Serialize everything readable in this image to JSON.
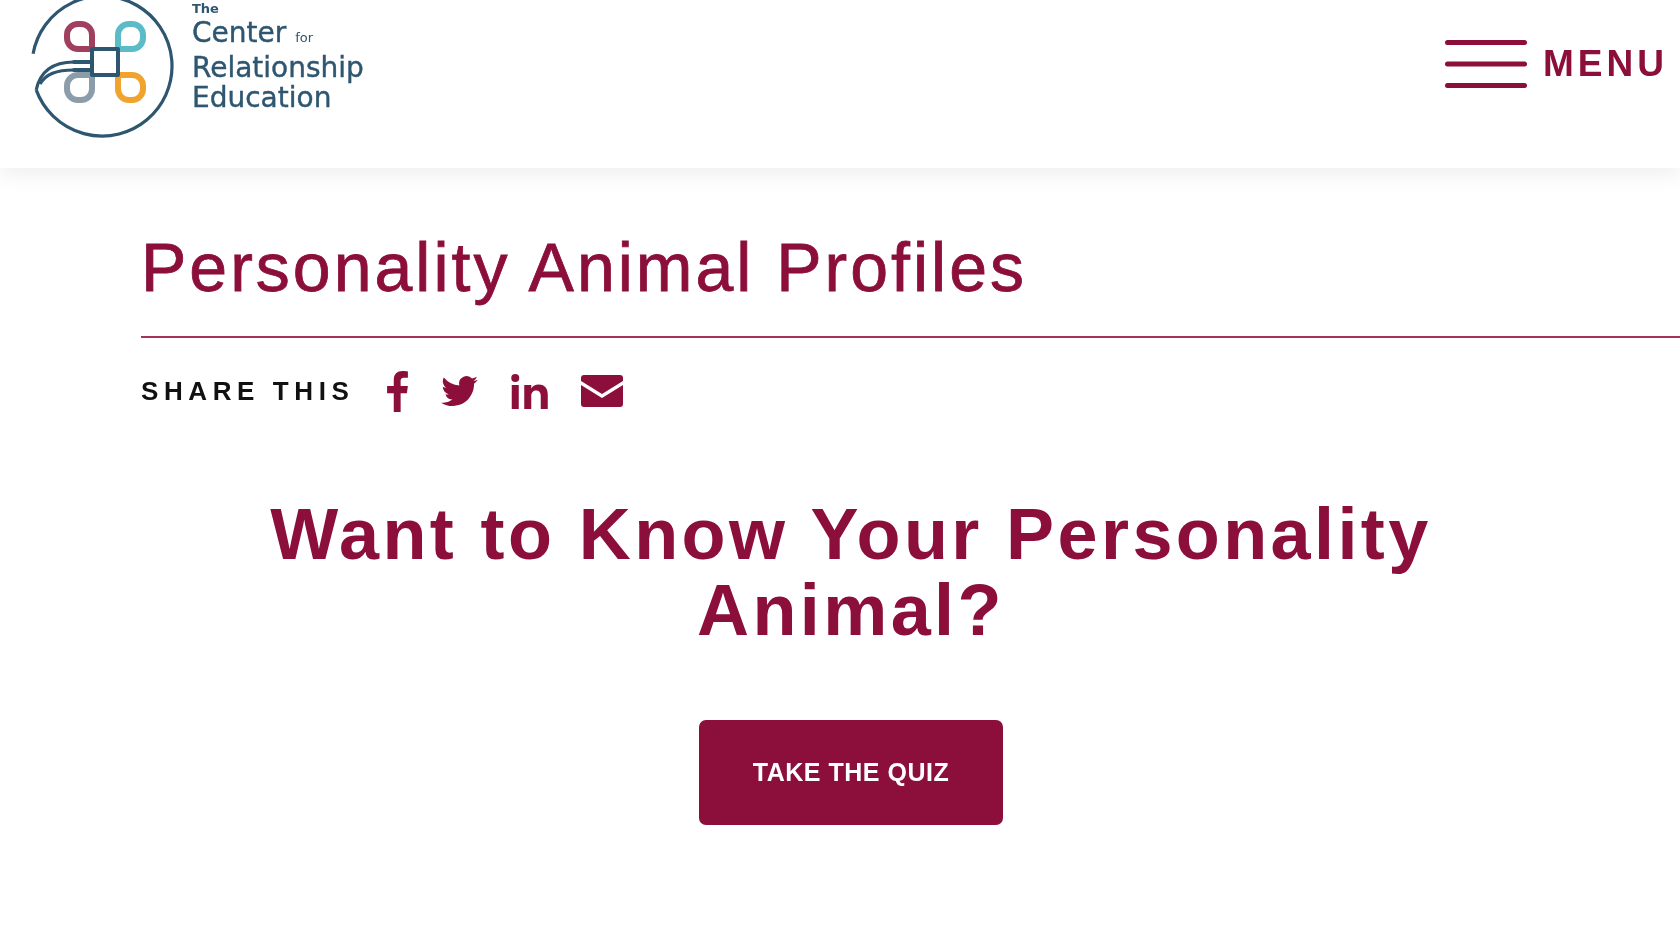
{
  "header": {
    "logo": {
      "top": "The",
      "line_1": "Center",
      "line_1_small": "for",
      "line_2": "Relationship",
      "line_3": "Education"
    },
    "menu": {
      "label": "MENU"
    }
  },
  "page_title": "Personality Animal Profiles",
  "share": {
    "label": "SHARE THIS"
  },
  "cta": {
    "heading": "Want to Know Your Personality Animal?",
    "button": "TAKE THE QUIZ"
  }
}
